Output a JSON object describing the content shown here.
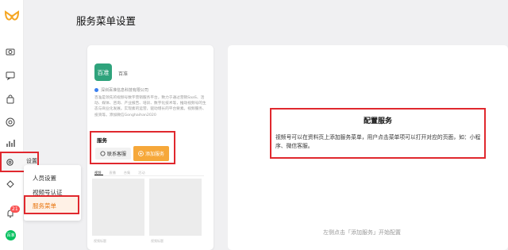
{
  "page_title": "服务菜单设置",
  "sidebar": {
    "badge_count": "21",
    "avatar_text": "百准",
    "settings_label": "设置",
    "icons": [
      "camera-icon",
      "message-icon",
      "bag-icon",
      "target-icon",
      "chart-icon",
      "settings-icon",
      "plugin-icon",
      "bell-icon"
    ]
  },
  "settings_menu": {
    "items": [
      "人员设置",
      "视频号认证",
      "服务菜单"
    ],
    "active_index": 2
  },
  "preview": {
    "logo_text": "百准",
    "org_name": "百准",
    "company": "深圳百准信息科技有限公司",
    "description": "百准是领先的视频号数字营销服务平台，致力于通过营销SaaS、活动、媒体、咨询、产业报告、培训、数字化技术等，推动视频号的生态与商业化发展。实现素的运营，驱动增长的平台要素。视频服务、投资等。添加微信Gonghaihan2020",
    "service_title": "服务",
    "contact_button": "联系客服",
    "add_service_button": "添加服务",
    "tabs": [
      "视频",
      "直播",
      "合集",
      "活动"
    ],
    "grid_captions": [
      "视频标题",
      "视频标题"
    ]
  },
  "config": {
    "title": "配置服务",
    "description": "视频号可以在资料页上添加服务菜单，用户点击菜单项可以打开对应的页面，如：小程序、微信客服。",
    "hint": "左侧点击「添加服务」开始配置"
  },
  "colors": {
    "highlight": "#e0282e",
    "accent_orange": "#f6a83a",
    "active_text": "#e8750f",
    "brand_green": "#07c160"
  }
}
